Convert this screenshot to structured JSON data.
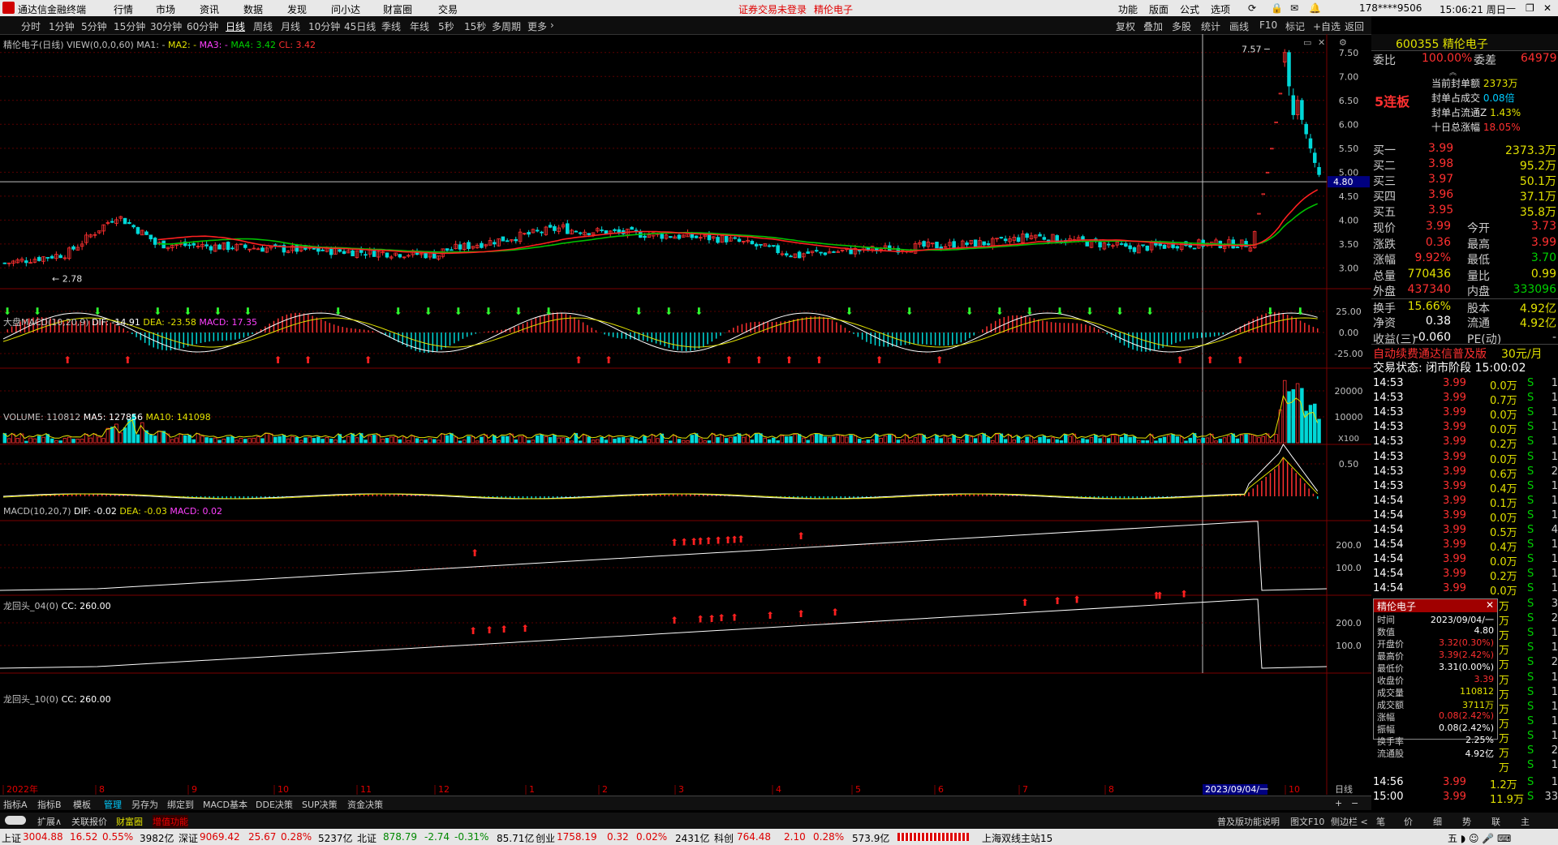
{
  "titlebar": {
    "app": "通达信金融终端",
    "menus": [
      "行情",
      "市场",
      "资讯",
      "数据",
      "发现",
      "问小达",
      "财富圈",
      "交易"
    ],
    "notice": "证券交易未登录",
    "stock": "精伦电子",
    "right_items": [
      "功能",
      "版面",
      "公式",
      "选项"
    ],
    "account": "178****9506",
    "clock": "15:06:21 周日"
  },
  "periods": [
    "分时",
    "1分钟",
    "5分钟",
    "15分钟",
    "30分钟",
    "60分钟",
    "日线",
    "周线",
    "月线",
    "10分钟",
    "45日线",
    "季线",
    "年线",
    "5秒",
    "15秒",
    "多周期",
    "更多"
  ],
  "active_period": "日线",
  "chart_tools": [
    "复权",
    "叠加",
    "多股",
    "统计",
    "画线",
    "F10",
    "标记",
    "+自选",
    "返回"
  ],
  "panels": {
    "main": {
      "label_name": "精伦电子(日线)",
      "label_view": "VIEW(0,0,0,60)",
      "ma1": "MA1: -",
      "ma2": "MA2: -",
      "ma3": "MA3: -",
      "ma4": "MA4: 3.42",
      "cl": "CL: 3.42",
      "yticks": [
        "7.50",
        "7.00",
        "6.50",
        "6.00",
        "5.50",
        "5.00",
        "4.50",
        "4.00",
        "3.50",
        "3.00"
      ],
      "hi_label": "7.57",
      "lo_label": "2.78",
      "cursor_price": "4.80"
    },
    "macd1": {
      "label": "大盘MACD(10,20,9)",
      "dif": "DIF: -14.91",
      "dea": "DEA: -23.58",
      "macd": "MACD: 17.35",
      "yticks": [
        "25.00",
        "0.00",
        "-25.00"
      ]
    },
    "volume": {
      "label": "VOLUME: 110812",
      "ma5": "MA5: 127856",
      "ma10": "MA10: 141098",
      "yticks": [
        "20000",
        "10000"
      ],
      "unit": "X100"
    },
    "macd2": {
      "label": "MACD(10,20,7)",
      "dif": "DIF: -0.02",
      "dea": "DEA: -0.03",
      "macd": "MACD: 0.02",
      "yticks": [
        "0.50"
      ]
    },
    "lhead4": {
      "label": "龙回头_04(0)",
      "cc": "CC: 260.00",
      "yticks": [
        "200.0",
        "100.0"
      ]
    },
    "lhead10": {
      "label": "龙回头_10(0)",
      "cc": "CC: 260.00",
      "yticks": [
        "200.0",
        "100.0"
      ]
    }
  },
  "xaxis": {
    "labels": [
      "2022年",
      "8",
      "9",
      "10",
      "11",
      "12",
      "1",
      "2",
      "3",
      "4",
      "5",
      "6",
      "7",
      "8",
      "9",
      "10"
    ],
    "cursor_date": "2023/09/04/一",
    "period": "日线"
  },
  "bottom_tabs": [
    "指标A",
    "指标B",
    "模板",
    "管理",
    "另存为",
    "绑定到",
    "MACD基本",
    "DDE决策",
    "SUP决策",
    "资金决策"
  ],
  "bottom_tabs2": [
    "扩展∧",
    "关联报价",
    "财富圈",
    "增值功能"
  ],
  "quote": {
    "code_name": "600355 精伦电子",
    "weibi_label": "委比",
    "weibi": "100.00%",
    "weicha_label": "委差",
    "weicha": "64979",
    "lianban": "5连板",
    "seal": [
      [
        "当前封单额",
        "2373万"
      ],
      [
        "封单占成交",
        "0.08倍"
      ],
      [
        "封单占流通Z",
        "1.43%"
      ],
      [
        "十日总涨幅",
        "18.05%"
      ]
    ],
    "bids": [
      [
        "买一",
        "3.99",
        "2373.3万"
      ],
      [
        "买二",
        "3.98",
        "95.2万"
      ],
      [
        "买三",
        "3.97",
        "50.1万"
      ],
      [
        "买四",
        "3.96",
        "37.1万"
      ],
      [
        "买五",
        "3.95",
        "35.8万"
      ]
    ],
    "stats": [
      [
        "现价",
        "3.99",
        "今开",
        "3.73"
      ],
      [
        "涨跌",
        "0.36",
        "最高",
        "3.99"
      ],
      [
        "涨幅",
        "9.92%",
        "最低",
        "3.70"
      ],
      [
        "总量",
        "770436",
        "量比",
        "0.99"
      ],
      [
        "外盘",
        "437340",
        "内盘",
        "333096"
      ],
      [
        "换手",
        "15.66%",
        "股本",
        "4.92亿"
      ],
      [
        "净资",
        "0.38",
        "流通",
        "4.92亿"
      ],
      [
        "收益(三)",
        "-0.060",
        "PE(动)",
        "-"
      ]
    ],
    "ad": "自动续费通达信普及版",
    "ad_price": "30元/月",
    "trade_state": "交易状态: 闭市阶段 15:00:02",
    "ticks": [
      [
        "14:53",
        "3.99",
        "0.0万",
        "S",
        "1"
      ],
      [
        "14:53",
        "3.99",
        "0.7万",
        "S",
        "1"
      ],
      [
        "14:53",
        "3.99",
        "0.0万",
        "S",
        "1"
      ],
      [
        "14:53",
        "3.99",
        "0.0万",
        "S",
        "1"
      ],
      [
        "14:53",
        "3.99",
        "0.2万",
        "S",
        "1"
      ],
      [
        "14:53",
        "3.99",
        "0.0万",
        "S",
        "1"
      ],
      [
        "14:53",
        "3.99",
        "0.6万",
        "S",
        "2"
      ],
      [
        "14:53",
        "3.99",
        "0.4万",
        "S",
        "1"
      ],
      [
        "14:54",
        "3.99",
        "0.1万",
        "S",
        "1"
      ],
      [
        "14:54",
        "3.99",
        "0.0万",
        "S",
        "1"
      ],
      [
        "14:54",
        "3.99",
        "0.5万",
        "S",
        "4"
      ],
      [
        "14:54",
        "3.99",
        "0.4万",
        "S",
        "1"
      ],
      [
        "14:54",
        "3.99",
        "0.0万",
        "S",
        "1"
      ],
      [
        "14:54",
        "3.99",
        "0.2万",
        "S",
        "1"
      ],
      [
        "14:54",
        "3.99",
        "0.0万",
        "S",
        "1"
      ]
    ],
    "ticks_tail": [
      [
        "14:56",
        "3.99",
        "1.2万",
        "S",
        "1"
      ],
      [
        "15:00",
        "3.99",
        "11.9万",
        "S",
        "33"
      ]
    ],
    "side_vals": [
      "万",
      "万",
      "万",
      "万",
      "万",
      "万",
      "万",
      "万",
      "万",
      "万",
      "万",
      "万"
    ],
    "side_counts": [
      "3",
      "2",
      "1",
      "1",
      "2",
      "1",
      "1",
      "1",
      "1",
      "1",
      "2",
      "1"
    ],
    "tabs": [
      "笔",
      "价",
      "细",
      "势",
      "联",
      "主"
    ]
  },
  "popup": {
    "title": "精伦电子",
    "rows": [
      [
        "时间",
        "2023/09/04/一"
      ],
      [
        "数值",
        "4.80"
      ],
      [
        "开盘价",
        "3.32(0.30%)"
      ],
      [
        "最高价",
        "3.39(2.42%)"
      ],
      [
        "最低价",
        "3.31(0.00%)"
      ],
      [
        "收盘价",
        "3.39"
      ],
      [
        "成交量",
        "110812"
      ],
      [
        "成交额",
        "3711万"
      ],
      [
        "涨幅",
        "0.08(2.42%)"
      ],
      [
        "振幅",
        "0.08(2.42%)"
      ],
      [
        "换手率",
        "2.25%"
      ],
      [
        "流通股",
        "4.92亿"
      ]
    ]
  },
  "indexbar": {
    "items": [
      [
        "上证",
        "3004.88",
        "16.52",
        "0.55%",
        "3982亿"
      ],
      [
        "深证",
        "9069.42",
        "25.67",
        "0.28%",
        "5237亿"
      ],
      [
        "北证",
        "878.79",
        "-2.74",
        "-0.31%",
        "85.71亿"
      ],
      [
        "创业",
        "1758.19",
        "0.32",
        "0.02%",
        "2431亿"
      ],
      [
        "科创",
        "764.48",
        "2.10",
        "0.28%",
        "573.9亿"
      ]
    ],
    "server": "上海双线主站15"
  },
  "status2": {
    "left": "普及版功能说明",
    "mid": "图文F10",
    "right": "侧边栏 <"
  },
  "colors": {
    "up": "#ff3030",
    "down": "#00d8d8",
    "ma_red": "#ff2020",
    "ma_green": "#00c000",
    "yellow": "#e0e000"
  }
}
